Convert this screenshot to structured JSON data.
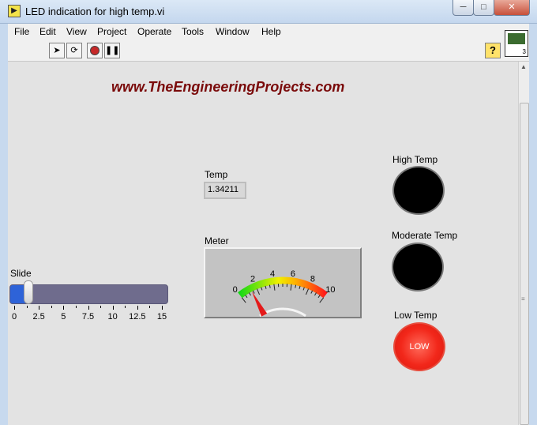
{
  "window": {
    "title": "LED indication for high temp.vi",
    "app_icon": "labview-vi-icon",
    "controls": {
      "minimize": "minimize-icon",
      "maximize": "maximize-icon",
      "close": "close-icon"
    }
  },
  "menubar": {
    "items": [
      "File",
      "Edit",
      "View",
      "Project",
      "Operate",
      "Tools",
      "Window",
      "Help"
    ]
  },
  "toolbar": {
    "run": "run-arrow-icon",
    "run_continuously": "run-continuously-icon",
    "abort": "abort-icon",
    "pause": "pause-icon",
    "help": "?",
    "vi_icon_number": "3"
  },
  "watermark": "www.TheEngineeringProjects.com",
  "temp": {
    "label": "Temp",
    "value": "1.34211"
  },
  "meter": {
    "label": "Meter",
    "min": 0,
    "max": 10,
    "tick_labels": [
      "0",
      "2",
      "4",
      "6",
      "8",
      "10"
    ],
    "value": 1.34211,
    "colors": {
      "low": "#16d916",
      "mid": "#f0f000",
      "high": "#ff1a1a",
      "needle": "#e41a1a"
    }
  },
  "slide": {
    "label": "Slide",
    "min": 0,
    "max": 15,
    "value": 1.34,
    "tick_labels": [
      "0",
      "2.5",
      "5",
      "7.5",
      "10",
      "12.5",
      "15"
    ]
  },
  "leds": {
    "high": {
      "label": "High Temp",
      "state": "off"
    },
    "moderate": {
      "label": "Moderate Temp",
      "state": "off"
    },
    "low": {
      "label": "Low Temp",
      "state": "on",
      "text": "LOW",
      "color": "#f2271a"
    }
  }
}
